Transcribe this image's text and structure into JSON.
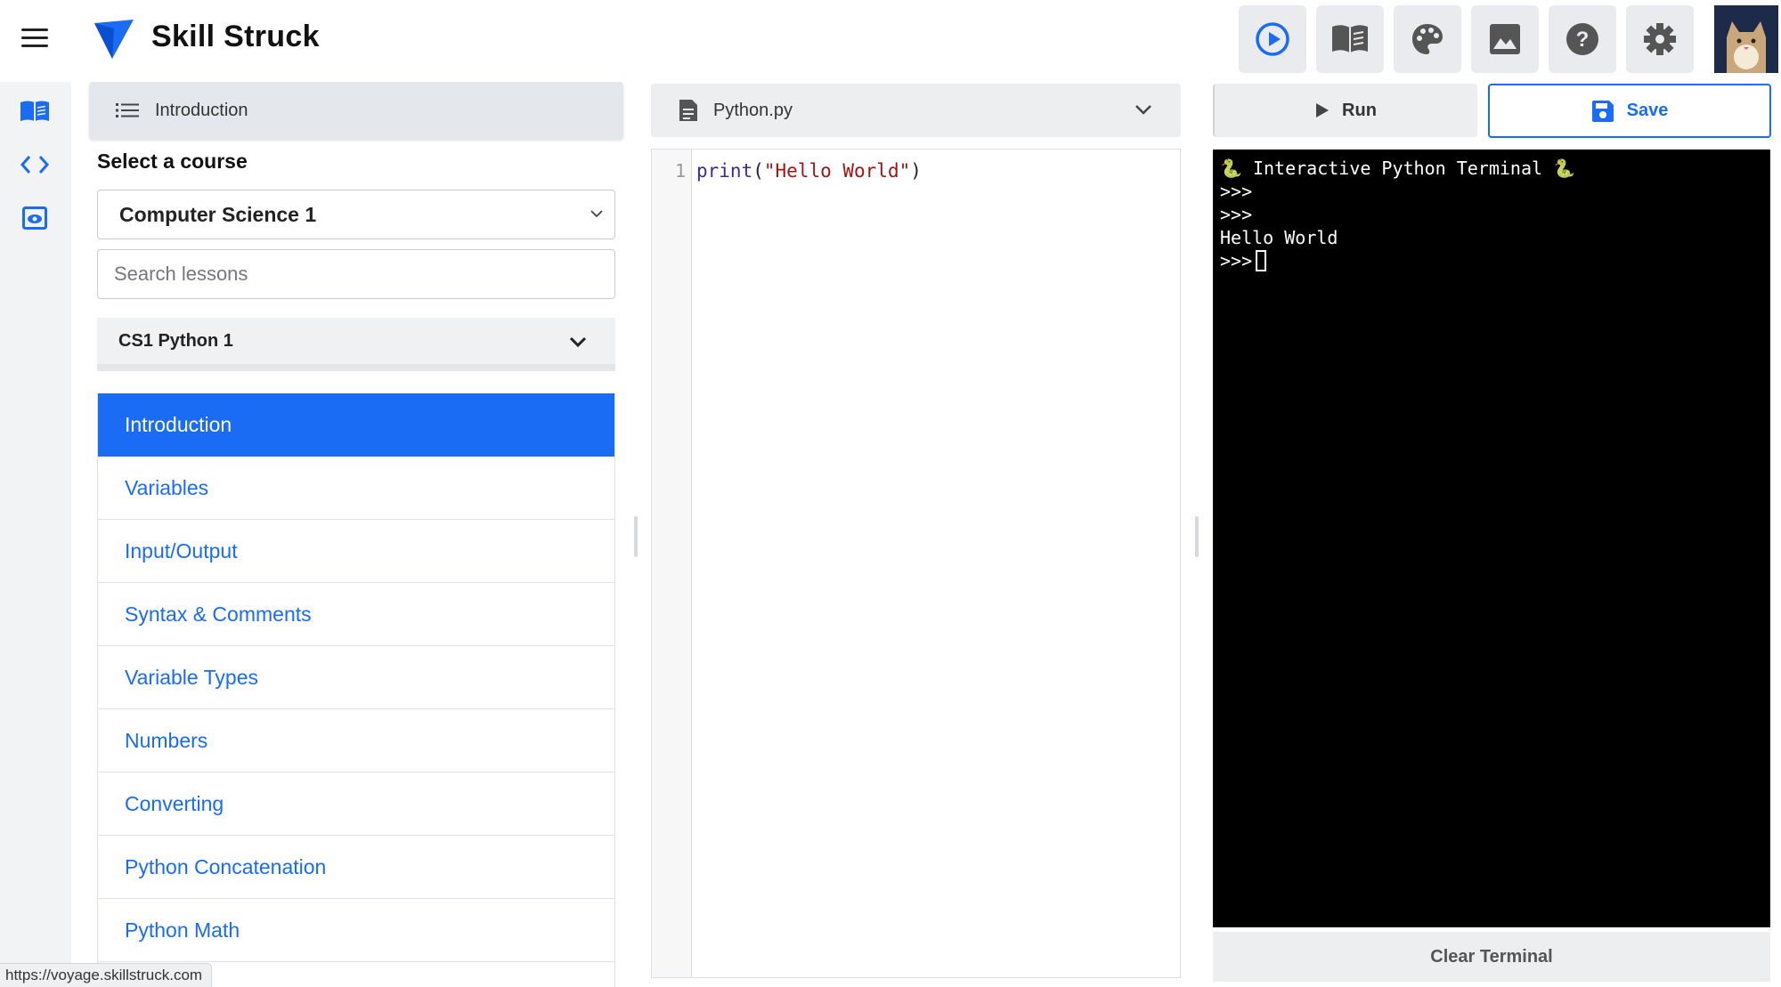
{
  "header": {
    "brand": "Skill Struck",
    "tools": [
      {
        "icon": "play-circle-icon"
      },
      {
        "icon": "book-icon"
      },
      {
        "icon": "palette-icon"
      },
      {
        "icon": "image-icon"
      },
      {
        "icon": "help-icon"
      },
      {
        "icon": "gear-icon"
      }
    ],
    "accent_color": "#1a6cf5"
  },
  "rail": {
    "items": [
      {
        "icon": "book-icon"
      },
      {
        "icon": "code-icon"
      },
      {
        "icon": "preview-icon"
      }
    ]
  },
  "lessons_panel": {
    "header_label": "Introduction",
    "select_label": "Select a course",
    "course": "Computer Science 1",
    "search_placeholder": "Search lessons",
    "unit": "CS1 Python 1",
    "lessons": [
      "Introduction",
      "Variables",
      "Input/Output",
      "Syntax & Comments",
      "Variable Types",
      "Numbers",
      "Converting",
      "Python Concatenation",
      "Python Math"
    ],
    "active_index": 0
  },
  "editor": {
    "file_name": "Python.py",
    "line_number": "1",
    "code": {
      "fn": "print",
      "open": "(",
      "str": "\"Hello World\"",
      "close": ")"
    }
  },
  "terminal": {
    "run_label": "Run",
    "save_label": "Save",
    "lines": [
      "🐍 Interactive Python Terminal 🐍",
      ">>>",
      ">>>",
      "Hello World"
    ],
    "prompt": ">>>",
    "clear_label": "Clear Terminal"
  },
  "status": {
    "url": "https://voyage.skillstruck.com"
  }
}
